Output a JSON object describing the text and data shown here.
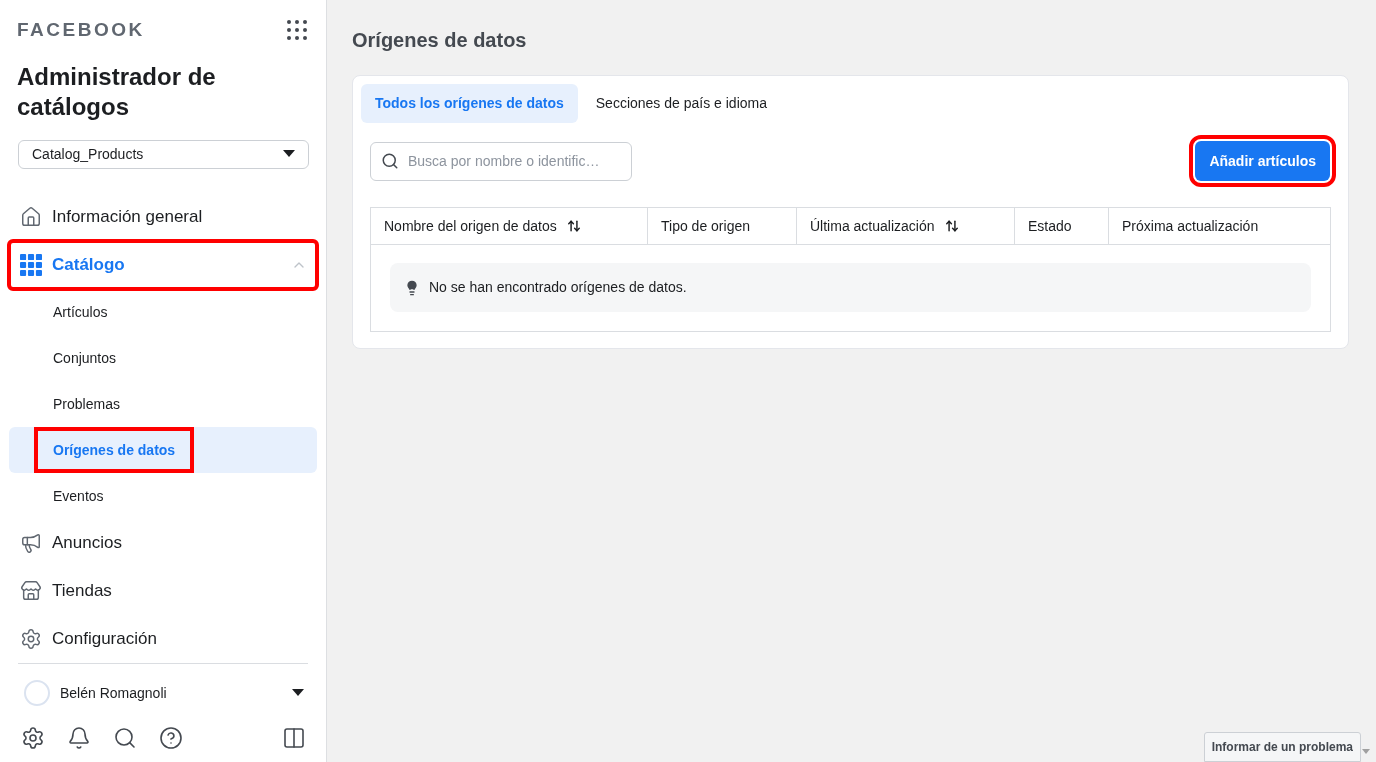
{
  "brand": "FACEBOOK",
  "app_title": "Administrador de catálogos",
  "catalog_select": {
    "value": "Catalog_Products"
  },
  "nav": [
    {
      "label": "Información general",
      "kind": "home",
      "selected": false,
      "highlighted": false
    },
    {
      "label": "Catálogo",
      "kind": "grid",
      "selected": true,
      "expanded": true,
      "highlighted": true,
      "children": [
        {
          "label": "Artículos",
          "selected": false,
          "highlighted": false
        },
        {
          "label": "Conjuntos",
          "selected": false,
          "highlighted": false
        },
        {
          "label": "Problemas",
          "selected": false,
          "highlighted": false
        },
        {
          "label": "Orígenes de datos",
          "selected": true,
          "highlighted": true
        },
        {
          "label": "Eventos",
          "selected": false,
          "highlighted": false
        }
      ]
    },
    {
      "label": "Anuncios",
      "kind": "megaphone",
      "selected": false,
      "highlighted": false
    },
    {
      "label": "Tiendas",
      "kind": "store",
      "selected": false,
      "highlighted": false
    },
    {
      "label": "Configuración",
      "kind": "settings",
      "selected": false,
      "highlighted": false
    }
  ],
  "user": {
    "name": "Belén Romagnoli"
  },
  "page_title": "Orígenes de datos",
  "tabs": [
    {
      "label": "Todos los orígenes de datos",
      "selected": true
    },
    {
      "label": "Secciones de país e idioma",
      "selected": false
    }
  ],
  "search": {
    "placeholder": "Busca por nombre o identific…"
  },
  "add_button": {
    "label": "Añadir artículos",
    "highlighted": true
  },
  "table": {
    "columns": [
      {
        "label": "Nombre del origen de datos",
        "sortable": true
      },
      {
        "label": "Tipo de origen",
        "sortable": false
      },
      {
        "label": "Última actualización",
        "sortable": true
      },
      {
        "label": "Estado",
        "sortable": false
      },
      {
        "label": "Próxima actualización",
        "sortable": false
      }
    ],
    "empty_message": "No se han encontrado orígenes de datos."
  },
  "report_button": "Informar de un problema"
}
